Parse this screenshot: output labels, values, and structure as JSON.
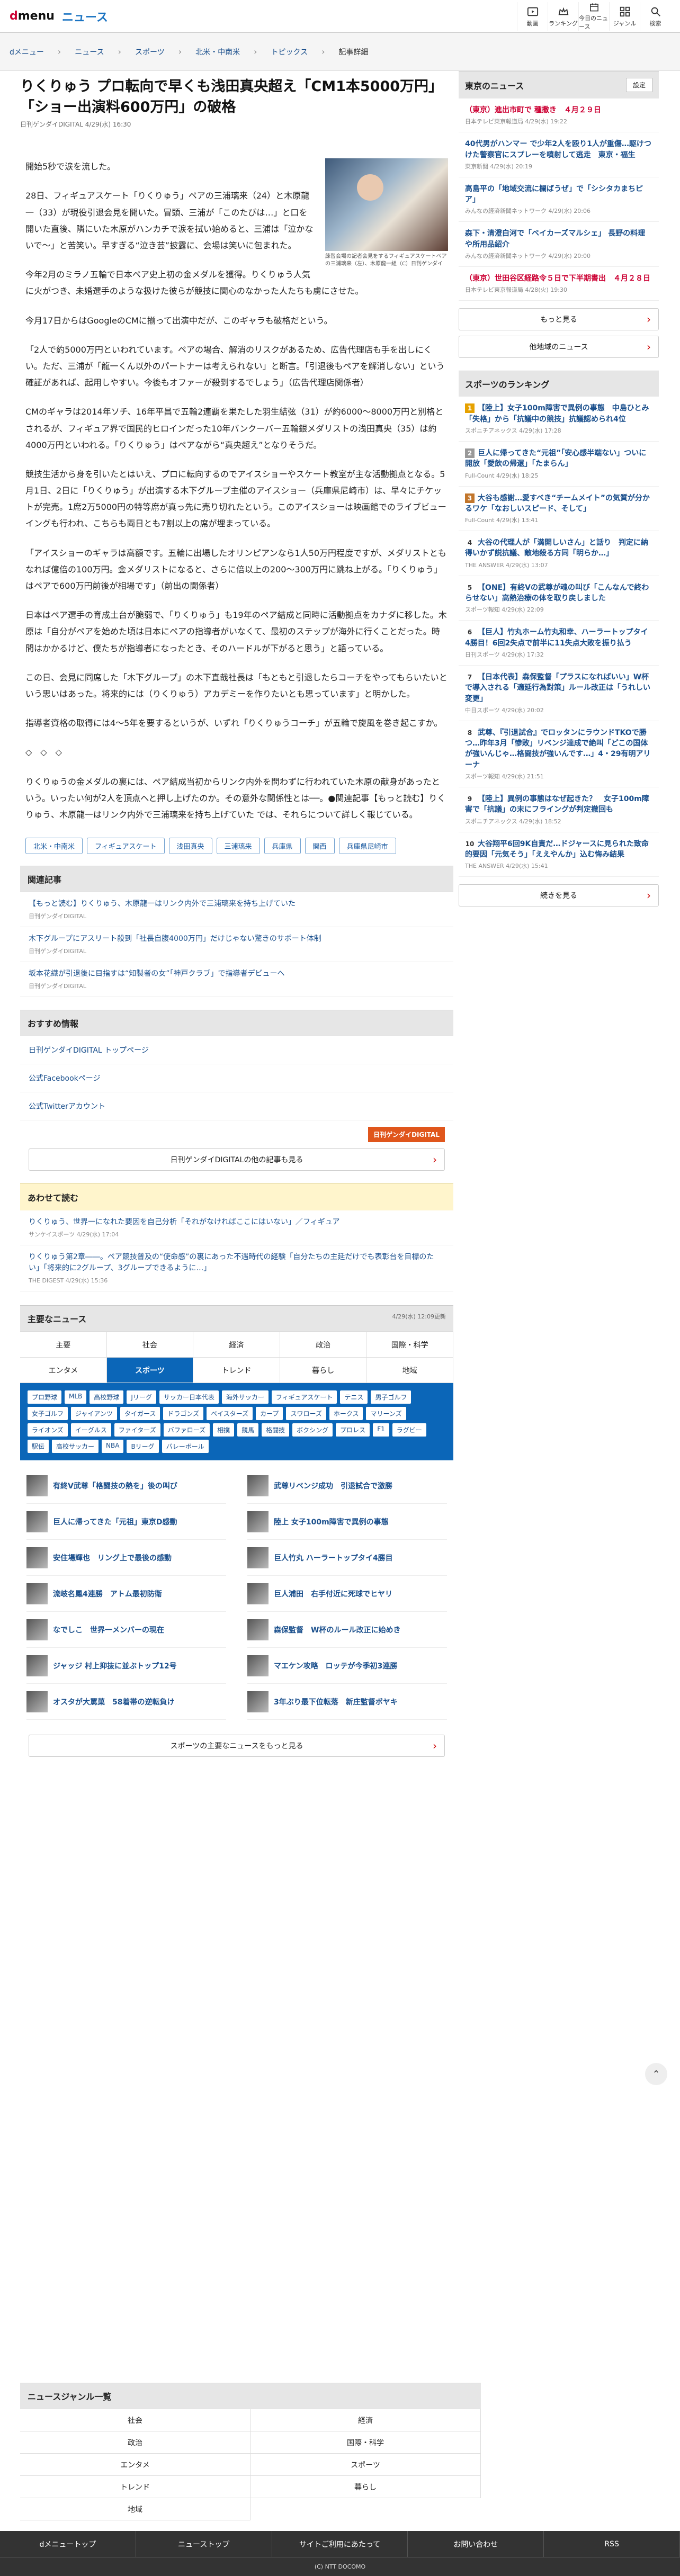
{
  "header": {
    "logo_d": "d",
    "logo_menu": "menu",
    "logo_news": "ニュース",
    "icons": [
      {
        "label": "動画",
        "icon": "play-icon"
      },
      {
        "label": "ランキング",
        "icon": "crown-icon"
      },
      {
        "label": "今日のニュース",
        "icon": "calendar-icon"
      },
      {
        "label": "ジャンル",
        "icon": "grid-icon"
      },
      {
        "label": "検索",
        "icon": "search-icon"
      }
    ]
  },
  "breadcrumb": [
    "dメニュー",
    "ニュース",
    "スポーツ",
    "北米・中南米",
    "トピックス",
    "記事詳細"
  ],
  "article": {
    "title": "りくりゅう プロ転向で早くも浅田真央超え「CM1本5000万円」「ショー出演料600万円」の破格",
    "meta": "日刊ゲンダイDIGITAL 4/29(水) 16:30",
    "photo_caption": "練習会場の記者会見をするフィギュアスケートペアの三浦璃来（左）、木原龍一組（C）日刊ゲンダイ",
    "paragraphs": [
      "開始5秒で涙を流した。",
      "28日、フィギュアスケート「りくりゅう」ペアの三浦璃来（24）と木原龍一（33）が現役引退会見を開いた。冒頭、三浦が「このたびは…」と口を開いた直後、隣にいた木原がハンカチで涙を拭い始めると、三浦は「泣かないで〜」と苦笑い。早すぎる“泣き芸”披露に、会場は笑いに包まれた。",
      "今年2月のミラノ五輪で日本ペア史上初の金メダルを獲得。りくりゅう人気に火がつき、未婚選手のような扱けた彼らが競技に関心のなかった人たちも虜にさせた。",
      "今月17日からはGoogleのCMに揃って出演中だが、このギャラも破格だという。",
      "「2人で約5000万円といわれています。ペアの場合、解消のリスクがあるため、広告代理店も手を出しにくい。ただ、三浦が「龍一くん以外のパートナーは考えられない」と断言。「引退後もペアを解消しない」という確証があれば、起用しやすい。今後もオファーが殺到するでしょう」（広告代理店関係者）",
      "CMのギャラは2014年ソチ、16年平昌で五輪2連覇を果たした羽生結弦（31）が約6000〜8000万円と別格とされるが、フィギュア界で国民的ヒロインだった10年バンクーバー五輪銀メダリストの浅田真央（35）は約4000万円といわれる。「りくりゅう」はペアながら“真央超え”となりそうだ。",
      "競技生活から身を引いたとはいえ、プロに転向するのでアイスショーやスケート教室が主な活動拠点となる。5月1日、2日に「りくりゅう」が出演する木下グループ主催のアイスショー（兵庫県尼崎市）は、早々にチケットが完売。1席2万5000円の特等席が真っ先に売り切れたという。このアイスショーは映画館でのライブビューイングも行われ、こちらも両日とも7割以上の席が埋まっている。",
      "「アイスショーのギャラは高額です。五輪に出場したオリンピアンなら1人50万円程度ですが、メダリストともなれば億倍の100万円。金メダリストになると、さらに倍以上の200〜300万円に跳ね上がる。「りくりゅう」はペアで600万円前後が相場です」（前出の関係者）",
      "日本はペア選手の育成土台が脆弱で、「りくりゅう」も19年のペア結成と同時に活動拠点をカナダに移した。木原は「自分がペアを始めた頃は日本にペアの指導者がいなくて、最初のステップが海外に行くことだった。時間はかかるけど、僕たちが指導者になったとき、そのハードルが下がると思う」と語っている。",
      "この日、会見に同席した「木下グループ」の木下直哉社長は「もともと引退したらコーチをやってもらいたいという思いはあった。将来的には（りくりゅう）アカデミーを作りたいとも思っています」と明かした。",
      "指導者資格の取得には4〜5年を要するというが、いずれ「りくりゅうコーチ」が五輪で旋風を巻き起こすか。",
      "◇　◇　◇",
      "りくりゅうの金メダルの裏には、ペア結成当初からリンク内外を問わずに行われていた木原の献身があったという。いったい何が2人を頂点へと押し上げたのか。その意外な関係性とは──。●関連記事【もっと読む】りくりゅう、木原龍一はリンク内外で三浦璃来を持ち上げていた では、それらについて詳しく報じている。"
    ],
    "tags": [
      "北米・中南米",
      "フィギュアスケート",
      "浅田真央",
      "三浦璃来",
      "兵庫県",
      "関西",
      "兵庫県尼崎市"
    ]
  },
  "related": {
    "heading": "関連記事",
    "items": [
      {
        "title": "【もっと読む】りくりゅう、木原龍一はリンク内外で三浦璃来を持ち上げていた",
        "src": "日刊ゲンダイDIGITAL"
      },
      {
        "title": "木下グループにアスリート殺到「社長自腹4000万円」だけじゃない驚きのサポート体制",
        "src": "日刊ゲンダイDIGITAL"
      },
      {
        "title": "坂本花織が引退後に目指すは“知製者の女”「神戸クラブ」で指導者デビューへ",
        "src": "日刊ゲンダイDIGITAL"
      }
    ]
  },
  "recommend": {
    "heading": "おすすめ情報",
    "links": [
      "日刊ゲンダイDIGITAL トップページ",
      "公式Facebookページ",
      "公式Twitterアカウント"
    ],
    "logo": "日刊ゲンダイDIGITAL",
    "more": "日刊ゲンダイDIGITALの他の記事も見る"
  },
  "also_read": {
    "heading": "あわせて読む",
    "items": [
      {
        "title": "りくりゅう、世界一になれた要因を自己分析「それがなければここにはいない」／フィギュア",
        "src": "サンケイスポーツ 4/29(水) 17:04"
      },
      {
        "title": "りくりゅう第2章――。ペア競技普及の“使命感”の裏にあった不遇時代の経験「自分たちの主延だけでも表彰台を目標のたい」「将来的に2グループ、3グループできるように…」",
        "src": "THE DIGEST 4/29(水) 15:36"
      }
    ]
  },
  "major": {
    "heading": "主要なニュース",
    "updated": "4/29(水) 12:09更新",
    "tabs_row1": [
      "主要",
      "社会",
      "経済",
      "政治",
      "国際・科学"
    ],
    "tabs_row2": [
      "エンタメ",
      "スポーツ",
      "トレンド",
      "暮らし",
      "地域"
    ],
    "chips": [
      "プロ野球",
      "MLB",
      "高校野球",
      "Jリーグ",
      "サッカー日本代表",
      "海外サッカー",
      "フィギュアスケート",
      "テニス",
      "男子ゴルフ",
      "女子ゴルフ",
      "ジャイアンツ",
      "タイガース",
      "ドラゴンズ",
      "ベイスターズ",
      "カープ",
      "スワローズ",
      "ホークス",
      "マリーンズ",
      "ライオンズ",
      "イーグルス",
      "ファイターズ",
      "バファローズ",
      "相撲",
      "競馬",
      "格闘技",
      "ボクシング",
      "プロレス",
      "F1",
      "ラグビー",
      "駅伝",
      "高校サッカー",
      "NBA",
      "Bリーグ",
      "バレーボール"
    ],
    "news": [
      "有終V武尊「格闘技の熱を」後の叫び",
      "武尊リベンジ成功　引退試合で激勝",
      "巨人に帰ってきた「元祖」東京D感動",
      "陸上 女子100m障害で異例の事態",
      "安住場輝也　リング上で最後の感動",
      "巨人竹丸 ハーラートップタイ4勝目",
      "流岐名鳳4連勝　アトム最初防衛",
      "巨人浦田　右手付近に死球でヒヤリ",
      "なでしこ　世界一メンバーの現在",
      "森保監督　W杯のルール改正に始めき",
      "ジャッジ 村上抑抜に並ぶトップ12号",
      "マエケン攻略　ロッテが今季初3連勝",
      "オスタが大罵菓　58着帯の逆転負け",
      "3年ぶり最下位転落　新庄監督ボヤキ"
    ],
    "more": "スポーツの主要なニュースをもっと見る"
  },
  "genre": {
    "heading": "ニュースジャンル一覧",
    "items": [
      "社会",
      "経済",
      "政治",
      "国際・科学",
      "エンタメ",
      "スポーツ",
      "トレンド",
      "暮らし",
      "地域"
    ]
  },
  "footer": {
    "links": [
      "dメニュートップ",
      "ニューストップ",
      "サイトご利用にあたって",
      "お問い合わせ",
      "RSS"
    ],
    "copyright": "(C) NTT DOCOMO"
  },
  "sidebar": {
    "tokyo": {
      "heading": "東京のニュース",
      "setting": "設定",
      "items": [
        {
          "title": "（東京）進出市町で 種撒き　４月２９日",
          "src": "日本テレビ東京報道局 4/29(水) 19:22",
          "red": true
        },
        {
          "title": "40代男がハンマー で少年2人を殴り1人が重傷…駆けつけた警察官にスプレーを噴射して逃走　東京・福生",
          "src": "東京新聞 4/29(水) 20:19"
        },
        {
          "title": "高島平の「地域交流に欄ばうぜ」で「シシタカまちピア」",
          "src": "みんなの経済新聞ネットワーク 4/29(水) 20:06"
        },
        {
          "title": "森下・清澄白河で「ベイカーズマルシェ」 長野の料理や所用品紹介",
          "src": "みんなの経済新聞ネットワーク 4/29(水) 20:00"
        },
        {
          "title": "（東京）世田谷区経路令５日で下半期書出　４月２８日",
          "src": "日本テレビ東京報道局 4/28(火) 19:30",
          "red": true
        }
      ],
      "more": "もっと見る",
      "other": "他地域のニュース"
    },
    "ranking": {
      "heading": "スポーツのランキング",
      "items": [
        {
          "title": "【陸上】女子100m障害で異例の事態　中島ひとみ「失格」から「抗議中の競技」抗議認められ4位",
          "src": "スポニチアネックス 4/29(水) 17:28"
        },
        {
          "title": "巨人に帰ってきた“元祖”「安心感半端ない」ついに開放「愛飲の帰還」「たまらん」",
          "src": "Full-Count 4/29(水) 18:25"
        },
        {
          "title": "大谷も感謝…愛すべき“チームメイト”の気質が分かるワケ「なおしいスピード、そして」",
          "src": "Full-Count 4/29(水) 13:41"
        },
        {
          "title": "大谷の代理人が「満開しいさん」と話り　判定に納得いかず説抗議、敵地殺る方同「明らか…」",
          "src": "THE ANSWER 4/29(水) 13:07"
        },
        {
          "title": "【ONE】有終Vの武尊が魂の叫び「こんなんで終わらせない」高熱治療の体を取り戻しました",
          "src": "スポーツ報知 4/29(水) 22:09"
        },
        {
          "title": "【巨人】竹丸ホーム竹丸和幸、ハーラートップタイ4勝目！6回2失点で前半に11失点大敗を振り払う",
          "src": "日刊スポーツ 4/29(水) 17:32"
        },
        {
          "title": "【日本代表】森保監督「プラスになればいい」W杯で導入される「適延行為對策」ルール改正は「うれしい変更」",
          "src": "中日スポーツ 4/29(水) 20:02"
        },
        {
          "title": "武尊、『引退試合』でロッタンにラウンドTKOで勝つ…昨年3月「惨敗」リベンジ達成で絶叫「どこの国体が強いんじゃ…格闘技が強いんです…」4・29有明アリーナ",
          "src": "スポーツ報知 4/29(水) 21:51"
        },
        {
          "title": "【陸上】異例の事態はなぜ起きた？　女子100m障害で「抗議」の末にフライングが判定撤回も",
          "src": "スポニチアネックス 4/29(水) 18:52"
        },
        {
          "title": "大谷翔平6回9K自責だ…ドジャースに見られた致命的要因「元気そう」「ええやんか」込む悔み結果",
          "src": "THE ANSWER 4/29(水) 15:41"
        }
      ],
      "more": "続きを見る"
    }
  }
}
